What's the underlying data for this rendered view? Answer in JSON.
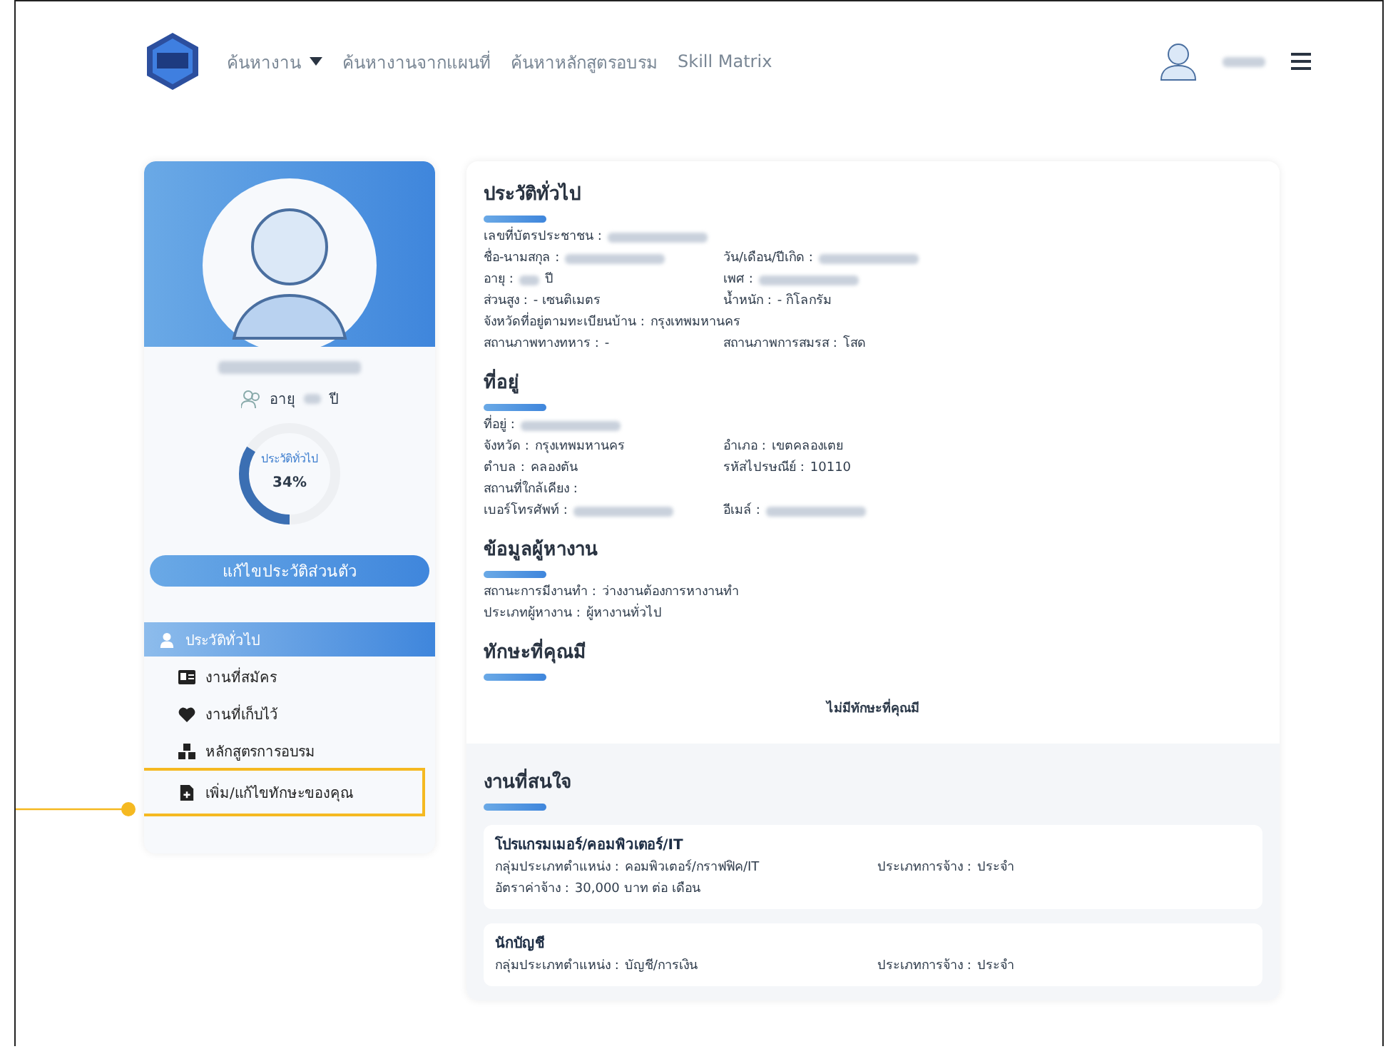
{
  "nav": {
    "links": [
      {
        "label": "ค้นหางาน",
        "dropdown": true
      },
      {
        "label": "ค้นหางานจากแผนที่",
        "dropdown": false
      },
      {
        "label": "ค้นหาหลักสูตรอบรม",
        "dropdown": false
      },
      {
        "label": "Skill Matrix",
        "dropdown": false
      }
    ]
  },
  "profile": {
    "age_label": "อายุ",
    "age_unit": "ปี",
    "progress": {
      "label": "ประวัติทั่วไป",
      "reading": "34%",
      "level": 0.34
    },
    "edit_button": "แก้ไขประวัติส่วนตัว"
  },
  "menu": [
    {
      "label": "ประวัติทั่วไป",
      "kind": "user",
      "selected": true,
      "highlighted": false
    },
    {
      "label": "งานที่สมัคร",
      "kind": "card",
      "selected": false,
      "highlighted": false
    },
    {
      "label": "งานที่เก็บไว้",
      "kind": "heart",
      "selected": false,
      "highlighted": false
    },
    {
      "label": "หลักสูตรการอบรม",
      "kind": "cubes",
      "selected": false,
      "highlighted": false
    },
    {
      "label": "เพิ่ม/แก้ไขทักษะของคุณ",
      "kind": "file",
      "selected": false,
      "highlighted": true
    }
  ],
  "sections": [
    {
      "title": "ประวัติทั่วไป",
      "rows": [
        [
          {
            "label": "เลขที่บัตรประชาชน :",
            "kind": "masked"
          }
        ],
        [
          {
            "label": "ชื่อ-นามสกุล :",
            "kind": "masked"
          },
          {
            "label": "วัน/เดือน/ปีเกิด :",
            "kind": "masked"
          }
        ],
        [
          {
            "label": "อายุ :",
            "kind": "masked",
            "value": "ปี"
          },
          {
            "label": "เพศ :",
            "kind": "masked"
          }
        ],
        [
          {
            "label": "ส่วนสูง :",
            "kind": "text",
            "value": "- เซนติเมตร"
          },
          {
            "label": "น้ำหนัก :",
            "kind": "text",
            "value": "- กิโลกรัม"
          }
        ],
        [
          {
            "label": "จังหวัดที่อยู่ตามทะเบียนบ้าน :",
            "kind": "text",
            "value": "กรุงเทพมหานคร"
          }
        ],
        [
          {
            "label": "สถานภาพทางทหาร :",
            "kind": "text",
            "value": "-"
          },
          {
            "label": "สถานภาพการสมรส :",
            "kind": "text",
            "value": "โสด"
          }
        ]
      ]
    },
    {
      "title": "ที่อยู่",
      "rows": [
        [
          {
            "label": "ที่อยู่ :",
            "kind": "masked"
          }
        ],
        [
          {
            "label": "จังหวัด :",
            "kind": "text",
            "value": "กรุงเทพมหานคร"
          },
          {
            "label": "อำเภอ :",
            "kind": "text",
            "value": "เขตคลองเตย"
          }
        ],
        [
          {
            "label": "ตำบล :",
            "kind": "text",
            "value": "คลองตัน"
          },
          {
            "label": "รหัสไปรษณีย์ :",
            "kind": "text",
            "value": "10110"
          }
        ],
        [
          {
            "label": "สถานที่ใกล้เคียง :",
            "kind": "text"
          }
        ],
        [
          {
            "label": "เบอร์โทรศัพท์ :",
            "kind": "masked"
          },
          {
            "label": "อีเมล์ :",
            "kind": "masked"
          }
        ]
      ]
    },
    {
      "title": "ข้อมูลผู้หางาน",
      "rows": [
        [
          {
            "label": "สถานะการมีงานทำ :",
            "kind": "text",
            "value": "ว่างงานต้องการหางานทำ"
          }
        ],
        [
          {
            "label": "ประเภทผู้หางาน :",
            "kind": "text",
            "value": "ผู้หางานทั่วไป"
          }
        ]
      ]
    },
    {
      "title": "ทักษะที่คุณมี",
      "empty": "ไม่มีทักษะที่คุณมี"
    }
  ],
  "interests": {
    "title": "งานที่สนใจ",
    "jobs": [
      {
        "title": "โปรแกรมเมอร์/คอมพิวเตอร์/IT",
        "rows": [
          [
            {
              "label": "กลุ่มประเภทตำแหน่ง :",
              "value": "คอมพิวเตอร์/กราฟฟิค/IT"
            },
            {
              "label": "ประเภทการจ้าง :",
              "value": "ประจำ"
            }
          ],
          [
            {
              "label": "อัตราค่าจ้าง :",
              "value": "30,000 บาท ต่อ เดือน"
            }
          ]
        ]
      },
      {
        "title": "นักบัญชี",
        "rows": [
          [
            {
              "label": "กลุ่มประเภทตำแหน่ง :",
              "value": "บัญชี/การเงิน"
            },
            {
              "label": "ประเภทการจ้าง :",
              "value": "ประจำ"
            }
          ]
        ]
      }
    ]
  }
}
